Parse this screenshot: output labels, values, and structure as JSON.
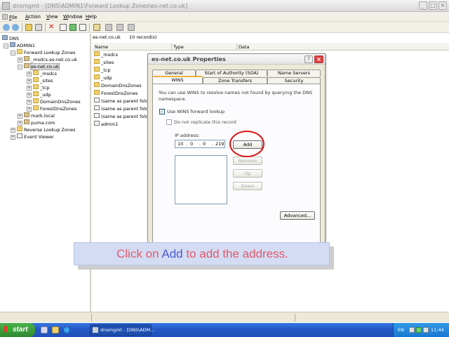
{
  "window": {
    "title": "dnsmgmt - [DNS\\ADMIN1\\Forward Lookup Zones\\es-net.co.uk]",
    "controls": [
      "_",
      "□",
      "×"
    ]
  },
  "menu": {
    "file": {
      "u": "F",
      "rest": "ile"
    },
    "action": {
      "u": "A",
      "rest": "ction"
    },
    "view": {
      "u": "V",
      "rest": "iew"
    },
    "window": {
      "u": "W",
      "rest": "indow"
    },
    "help": {
      "u": "H",
      "rest": "elp"
    }
  },
  "tree": {
    "items": [
      {
        "label": "DNS",
        "toggle": "",
        "icon": "server"
      },
      {
        "label": "ADMIN1",
        "toggle": "−",
        "icon": "server"
      },
      {
        "label": "Forward Lookup Zones",
        "toggle": "−",
        "icon": "folder"
      },
      {
        "label": "_msdcs.es-net.co.uk",
        "toggle": "+",
        "icon": "zone"
      },
      {
        "label": "es-net.co.uk",
        "toggle": "−",
        "icon": "zone"
      },
      {
        "label": "_msdcs",
        "toggle": "+",
        "icon": "folder"
      },
      {
        "label": "_sites",
        "toggle": "+",
        "icon": "folder"
      },
      {
        "label": "_tcp",
        "toggle": "+",
        "icon": "folder"
      },
      {
        "label": "_udp",
        "toggle": "+",
        "icon": "folder"
      },
      {
        "label": "DomainDnsZones",
        "toggle": "+",
        "icon": "folder"
      },
      {
        "label": "ForestDnsZones",
        "toggle": "+",
        "icon": "folder"
      },
      {
        "label": "mark.local",
        "toggle": "+",
        "icon": "zone"
      },
      {
        "label": "puma.com",
        "toggle": "+",
        "icon": "zone"
      },
      {
        "label": "Reverse Lookup Zones",
        "toggle": "+",
        "icon": "folder"
      },
      {
        "label": "Event Viewer",
        "toggle": "+",
        "icon": "doc"
      }
    ]
  },
  "list": {
    "header_zone": "es-net.co.uk",
    "header_count": "10 record(s)",
    "columns": [
      "Name",
      "Type",
      "Data"
    ],
    "rows": [
      {
        "name": "_msdcs",
        "icon": "folder"
      },
      {
        "name": "_sites",
        "icon": "folder"
      },
      {
        "name": "_tcp",
        "icon": "folder"
      },
      {
        "name": "_udp",
        "icon": "folder"
      },
      {
        "name": "DomainDnsZones",
        "icon": "folder"
      },
      {
        "name": "ForestDnsZones",
        "icon": "folder"
      },
      {
        "name": "(same as parent folder)",
        "icon": "doc"
      },
      {
        "name": "(same as parent folder)",
        "icon": "doc"
      },
      {
        "name": "(same as parent folder)",
        "icon": "doc"
      },
      {
        "name": "admin1",
        "icon": "doc"
      }
    ]
  },
  "dialog": {
    "title": "es-net.co.uk Properties",
    "help": "?",
    "close": "×",
    "tabs_row1": [
      "General",
      "Start of Authority (SOA)",
      "Name Servers"
    ],
    "tabs_row2": [
      "WINS",
      "Zone Transfers",
      "Security"
    ],
    "active_tab": "WINS",
    "description_line1": "You can use WINS to resolve names not found by querying the DNS",
    "description_line2": "namespace.",
    "use_wins_label": "Use WINS forward lookup",
    "use_wins_checked": true,
    "do_not_replicate_label": "Do not replicate this record",
    "do_not_replicate_checked": false,
    "ip_label": "IP address:",
    "ip_octets": [
      "10",
      "0",
      "0",
      "219"
    ],
    "add_button": "Add",
    "remove_button": "Remove",
    "up_button": "Up",
    "down_button": "Down",
    "advanced_button": "Advanced..."
  },
  "caption": {
    "prefix": "Click on ",
    "highlight": "Add",
    "suffix": " to add the address."
  },
  "taskbar": {
    "start_label": "start",
    "task_label": "dnsmgmt - [DNS\\ADM...",
    "language": "EN",
    "clock": "11:44"
  },
  "colors": {
    "caption_bg": "#d4dcf4",
    "caption_text": "#e05a6a",
    "caption_highlight": "#4a5ad0",
    "highlight_circle": "#e01010"
  }
}
